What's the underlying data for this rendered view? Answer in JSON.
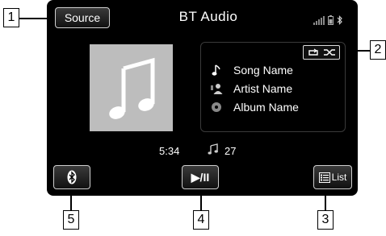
{
  "header": {
    "title": "BT Audio",
    "source_label": "Source"
  },
  "track": {
    "song": "Song Name",
    "artist": "Artist Name",
    "album": "Album Name",
    "elapsed_time": "5:34",
    "track_number": "27"
  },
  "controls": {
    "play_pause_label": "▶/II",
    "list_label": "List"
  },
  "callouts": [
    "1",
    "2",
    "3",
    "4",
    "5"
  ],
  "icons": {
    "signal": "signal-bars-icon",
    "battery": "battery-icon",
    "bluetooth": "bluetooth-icon",
    "repeat": "repeat-icon",
    "shuffle": "shuffle-icon",
    "music_note": "music-note-icon",
    "artist": "artist-icon",
    "album": "album-icon",
    "list": "list-icon"
  }
}
